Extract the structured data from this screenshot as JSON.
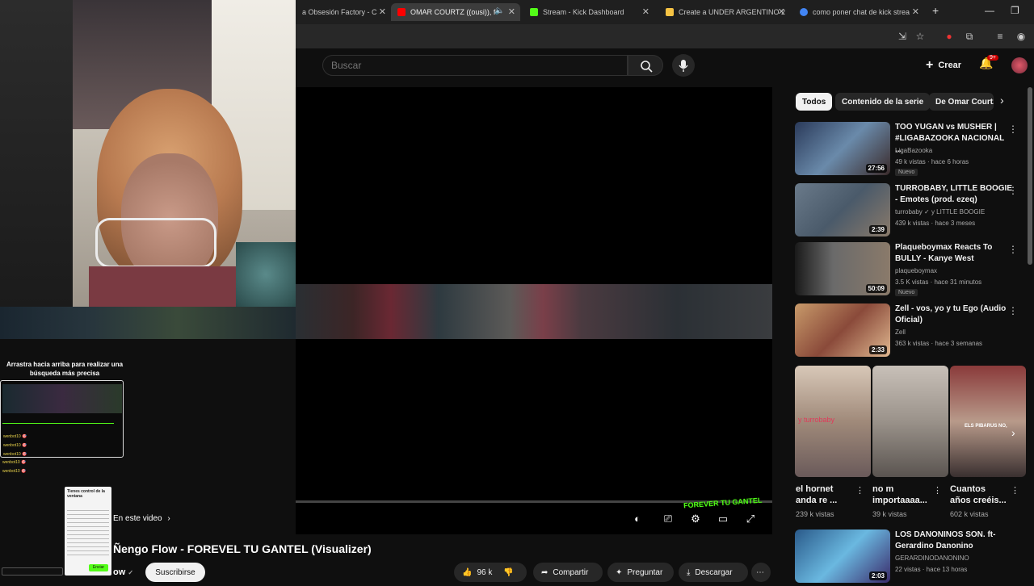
{
  "tabs": [
    {
      "label": "a Obsesión Factory - C",
      "favicon_color": "#cfa",
      "active": false
    },
    {
      "label": "OMAR COURTZ ((ousi)), f",
      "favicon_color": "#ff0000",
      "active": true
    },
    {
      "label": "Stream - Kick Dashboard",
      "favicon_color": "#53fc18",
      "active": false
    },
    {
      "label": "Create a UNDER ARGENTINO 2",
      "favicon_color": "#f6c344",
      "active": false
    },
    {
      "label": "como poner chat de kick strea",
      "favicon_color": "#4285f4",
      "active": false
    }
  ],
  "search": {
    "placeholder": "Buscar"
  },
  "header": {
    "create_label": "Crear",
    "notif_count": "9+"
  },
  "overlay": {
    "drag_hint": "Arrastra hacia arriba para realizar una búsqueda más precisa",
    "chat_users": [
      "wenbot10 🎯",
      "wenbot10 🎯",
      "wenbot10 🎯",
      "wenbot10 🎯",
      "wenbot10 🎯"
    ],
    "popup_title": "Tienes control de la ventana",
    "popup_send": "Enviar"
  },
  "video": {
    "in_video_label": "En este video",
    "title": "Ñengo Flow - FOREVEL TU GANTEL (Visualizer)",
    "channel_suffix": "ow",
    "watermark": "FOREVER TU GANTEL"
  },
  "actions": {
    "subscribe": "Suscribirse",
    "likes": "96 k",
    "share": "Compartir",
    "ask": "Preguntar",
    "download": "Descargar"
  },
  "chips": [
    "Todos",
    "Contenido de la serie",
    "De Omar Courtz"
  ],
  "recommendations": [
    {
      "title": "TOO YUGAN vs MUSHER | #LIGABAZOOKA NACIONAL ...",
      "channel": "LigaBazooka",
      "meta": "49 k vistas · hace 6 horas",
      "badge": "Nuevo",
      "duration": "27:56",
      "thumb_color": "#3b5b7d"
    },
    {
      "title": "TURROBABY, LITTLE BOOGIE - Emotes (prod. ezeq)",
      "channel": "turrobaby ✓ y LITTLE BOOGIE",
      "meta": "439 k vistas · hace 3 meses",
      "badge": "",
      "duration": "2:39",
      "thumb_color": "#5a6f80"
    },
    {
      "title": "Plaqueboymax Reacts To BULLY - Kanye West",
      "channel": "plaqueboymax",
      "meta": "3.5 K vistas · hace 31 minutos",
      "badge": "Nuevo",
      "duration": "50:09",
      "thumb_color": "#4a4a4a"
    },
    {
      "title": "Zell - vos, yo y tu Ego (Audio Oficial)",
      "channel": "Zell",
      "meta": "363 k vistas · hace 3 semanas",
      "badge": "",
      "duration": "2:33",
      "thumb_color": "#8a5a3a"
    }
  ],
  "shorts": [
    {
      "title": "el hornet anda re ...",
      "views": "239 k vistas",
      "overlay": "y turrobaby",
      "color": "#a08a7a"
    },
    {
      "title": "no m importaaaa...",
      "views": "39 k vistas",
      "overlay": "",
      "color": "#b8b0a8"
    },
    {
      "title": "Cuantos años creéis...",
      "views": "602 k vistas",
      "overlay": "ELS PIBARUS NO,",
      "color": "#6a3a3a"
    }
  ],
  "last_rec": {
    "title": "LOS DANONINOS SON. ft- Gerardino Danonino",
    "channel": "GERARDINODANONINO",
    "meta": "22 vistas · hace 13 horas",
    "duration": "2:03",
    "thumb_color": "#2a5a8a"
  }
}
